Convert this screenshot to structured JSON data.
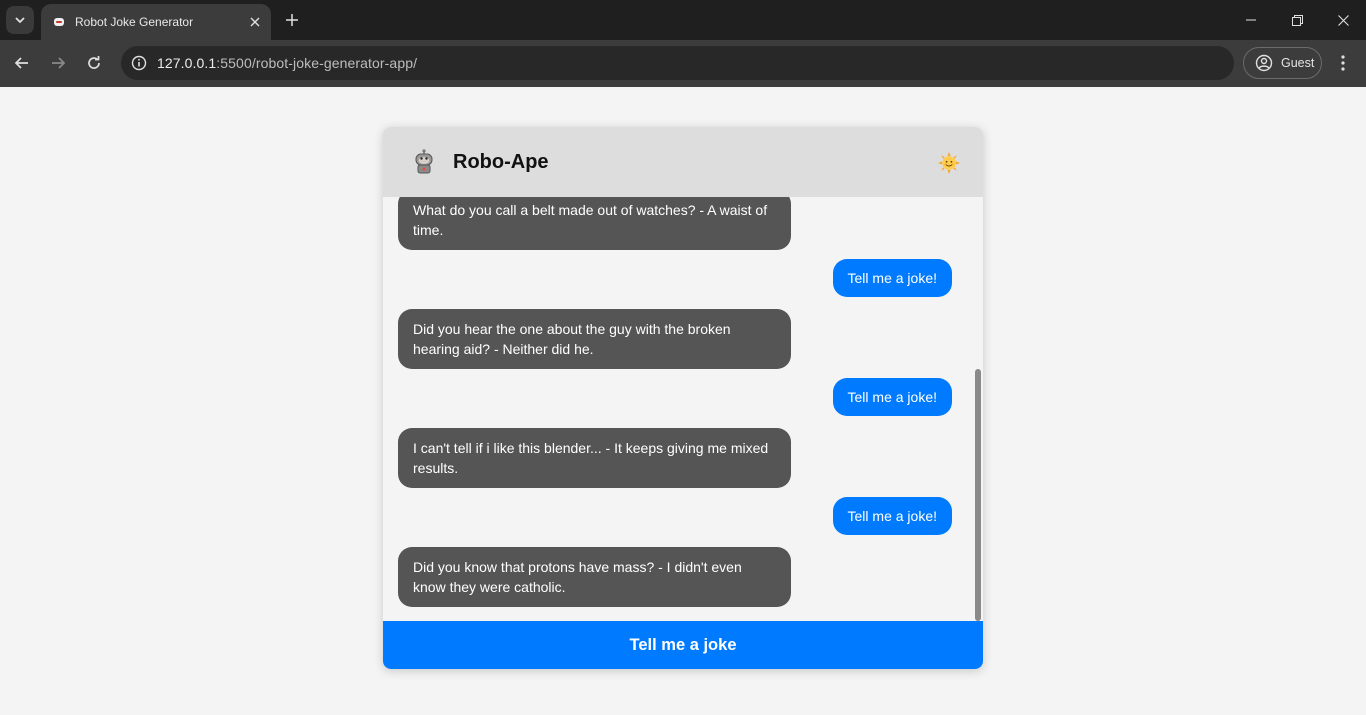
{
  "browser": {
    "tab_title": "Robot Joke Generator",
    "url_host": "127.0.0.1",
    "url_rest": ":5500/robot-joke-generator-app/",
    "profile_label": "Guest",
    "icons": [
      "tab-search-icon",
      "robot-favicon-icon",
      "close-tab-icon",
      "new-tab-icon",
      "minimize-icon",
      "restore-icon",
      "close-window-icon",
      "back-icon",
      "forward-icon",
      "reload-icon",
      "site-info-icon",
      "profile-icon",
      "more-menu-icon"
    ]
  },
  "app": {
    "title": "Robo-Ape",
    "theme_icon": "sun-face-icon",
    "messages": [
      {
        "from": "bot",
        "text": "What do you call a belt made out of watches? - A waist of time."
      },
      {
        "from": "user",
        "text": "Tell me a joke!"
      },
      {
        "from": "bot",
        "text": "Did you hear the one about the guy with the broken hearing aid? - Neither did he."
      },
      {
        "from": "user",
        "text": "Tell me a joke!"
      },
      {
        "from": "bot",
        "text": "I can't tell if i like this blender... - It keeps giving me mixed results."
      },
      {
        "from": "user",
        "text": "Tell me a joke!"
      },
      {
        "from": "bot",
        "text": "Did you know that protons have mass? - I didn't even know they were catholic."
      }
    ],
    "button_label": "Tell me a joke",
    "colors": {
      "user_bubble": "#007bff",
      "bot_bubble": "#555555",
      "header": "#dddddd"
    }
  }
}
